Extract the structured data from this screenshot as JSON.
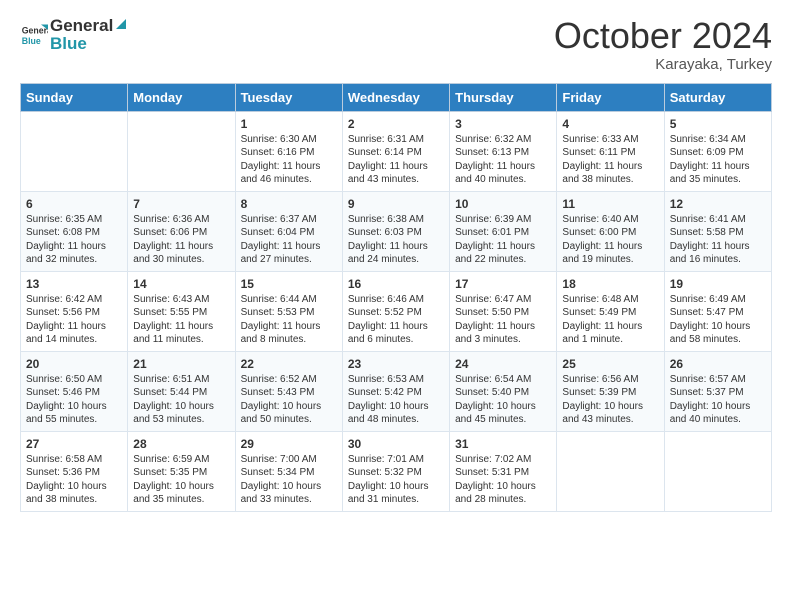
{
  "header": {
    "logo_line1": "General",
    "logo_line2": "Blue",
    "month": "October 2024",
    "location": "Karayaka, Turkey"
  },
  "weekdays": [
    "Sunday",
    "Monday",
    "Tuesday",
    "Wednesday",
    "Thursday",
    "Friday",
    "Saturday"
  ],
  "weeks": [
    [
      {
        "day": "",
        "sunrise": "",
        "sunset": "",
        "daylight": ""
      },
      {
        "day": "",
        "sunrise": "",
        "sunset": "",
        "daylight": ""
      },
      {
        "day": "1",
        "sunrise": "Sunrise: 6:30 AM",
        "sunset": "Sunset: 6:16 PM",
        "daylight": "Daylight: 11 hours and 46 minutes."
      },
      {
        "day": "2",
        "sunrise": "Sunrise: 6:31 AM",
        "sunset": "Sunset: 6:14 PM",
        "daylight": "Daylight: 11 hours and 43 minutes."
      },
      {
        "day": "3",
        "sunrise": "Sunrise: 6:32 AM",
        "sunset": "Sunset: 6:13 PM",
        "daylight": "Daylight: 11 hours and 40 minutes."
      },
      {
        "day": "4",
        "sunrise": "Sunrise: 6:33 AM",
        "sunset": "Sunset: 6:11 PM",
        "daylight": "Daylight: 11 hours and 38 minutes."
      },
      {
        "day": "5",
        "sunrise": "Sunrise: 6:34 AM",
        "sunset": "Sunset: 6:09 PM",
        "daylight": "Daylight: 11 hours and 35 minutes."
      }
    ],
    [
      {
        "day": "6",
        "sunrise": "Sunrise: 6:35 AM",
        "sunset": "Sunset: 6:08 PM",
        "daylight": "Daylight: 11 hours and 32 minutes."
      },
      {
        "day": "7",
        "sunrise": "Sunrise: 6:36 AM",
        "sunset": "Sunset: 6:06 PM",
        "daylight": "Daylight: 11 hours and 30 minutes."
      },
      {
        "day": "8",
        "sunrise": "Sunrise: 6:37 AM",
        "sunset": "Sunset: 6:04 PM",
        "daylight": "Daylight: 11 hours and 27 minutes."
      },
      {
        "day": "9",
        "sunrise": "Sunrise: 6:38 AM",
        "sunset": "Sunset: 6:03 PM",
        "daylight": "Daylight: 11 hours and 24 minutes."
      },
      {
        "day": "10",
        "sunrise": "Sunrise: 6:39 AM",
        "sunset": "Sunset: 6:01 PM",
        "daylight": "Daylight: 11 hours and 22 minutes."
      },
      {
        "day": "11",
        "sunrise": "Sunrise: 6:40 AM",
        "sunset": "Sunset: 6:00 PM",
        "daylight": "Daylight: 11 hours and 19 minutes."
      },
      {
        "day": "12",
        "sunrise": "Sunrise: 6:41 AM",
        "sunset": "Sunset: 5:58 PM",
        "daylight": "Daylight: 11 hours and 16 minutes."
      }
    ],
    [
      {
        "day": "13",
        "sunrise": "Sunrise: 6:42 AM",
        "sunset": "Sunset: 5:56 PM",
        "daylight": "Daylight: 11 hours and 14 minutes."
      },
      {
        "day": "14",
        "sunrise": "Sunrise: 6:43 AM",
        "sunset": "Sunset: 5:55 PM",
        "daylight": "Daylight: 11 hours and 11 minutes."
      },
      {
        "day": "15",
        "sunrise": "Sunrise: 6:44 AM",
        "sunset": "Sunset: 5:53 PM",
        "daylight": "Daylight: 11 hours and 8 minutes."
      },
      {
        "day": "16",
        "sunrise": "Sunrise: 6:46 AM",
        "sunset": "Sunset: 5:52 PM",
        "daylight": "Daylight: 11 hours and 6 minutes."
      },
      {
        "day": "17",
        "sunrise": "Sunrise: 6:47 AM",
        "sunset": "Sunset: 5:50 PM",
        "daylight": "Daylight: 11 hours and 3 minutes."
      },
      {
        "day": "18",
        "sunrise": "Sunrise: 6:48 AM",
        "sunset": "Sunset: 5:49 PM",
        "daylight": "Daylight: 11 hours and 1 minute."
      },
      {
        "day": "19",
        "sunrise": "Sunrise: 6:49 AM",
        "sunset": "Sunset: 5:47 PM",
        "daylight": "Daylight: 10 hours and 58 minutes."
      }
    ],
    [
      {
        "day": "20",
        "sunrise": "Sunrise: 6:50 AM",
        "sunset": "Sunset: 5:46 PM",
        "daylight": "Daylight: 10 hours and 55 minutes."
      },
      {
        "day": "21",
        "sunrise": "Sunrise: 6:51 AM",
        "sunset": "Sunset: 5:44 PM",
        "daylight": "Daylight: 10 hours and 53 minutes."
      },
      {
        "day": "22",
        "sunrise": "Sunrise: 6:52 AM",
        "sunset": "Sunset: 5:43 PM",
        "daylight": "Daylight: 10 hours and 50 minutes."
      },
      {
        "day": "23",
        "sunrise": "Sunrise: 6:53 AM",
        "sunset": "Sunset: 5:42 PM",
        "daylight": "Daylight: 10 hours and 48 minutes."
      },
      {
        "day": "24",
        "sunrise": "Sunrise: 6:54 AM",
        "sunset": "Sunset: 5:40 PM",
        "daylight": "Daylight: 10 hours and 45 minutes."
      },
      {
        "day": "25",
        "sunrise": "Sunrise: 6:56 AM",
        "sunset": "Sunset: 5:39 PM",
        "daylight": "Daylight: 10 hours and 43 minutes."
      },
      {
        "day": "26",
        "sunrise": "Sunrise: 6:57 AM",
        "sunset": "Sunset: 5:37 PM",
        "daylight": "Daylight: 10 hours and 40 minutes."
      }
    ],
    [
      {
        "day": "27",
        "sunrise": "Sunrise: 6:58 AM",
        "sunset": "Sunset: 5:36 PM",
        "daylight": "Daylight: 10 hours and 38 minutes."
      },
      {
        "day": "28",
        "sunrise": "Sunrise: 6:59 AM",
        "sunset": "Sunset: 5:35 PM",
        "daylight": "Daylight: 10 hours and 35 minutes."
      },
      {
        "day": "29",
        "sunrise": "Sunrise: 7:00 AM",
        "sunset": "Sunset: 5:34 PM",
        "daylight": "Daylight: 10 hours and 33 minutes."
      },
      {
        "day": "30",
        "sunrise": "Sunrise: 7:01 AM",
        "sunset": "Sunset: 5:32 PM",
        "daylight": "Daylight: 10 hours and 31 minutes."
      },
      {
        "day": "31",
        "sunrise": "Sunrise: 7:02 AM",
        "sunset": "Sunset: 5:31 PM",
        "daylight": "Daylight: 10 hours and 28 minutes."
      },
      {
        "day": "",
        "sunrise": "",
        "sunset": "",
        "daylight": ""
      },
      {
        "day": "",
        "sunrise": "",
        "sunset": "",
        "daylight": ""
      }
    ]
  ]
}
